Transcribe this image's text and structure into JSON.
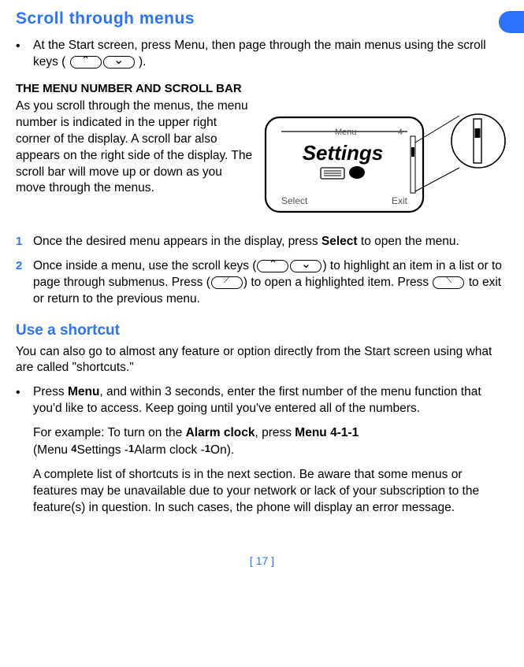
{
  "h1": "Scroll through menus",
  "bullet1_a": "At the Start screen, press Menu, then page through the main menus using the scroll keys (",
  "bullet1_b": ").",
  "subhead": "THE MENU NUMBER AND SCROLL BAR",
  "para1": "As you scroll through the menus, the menu number is indicated in the upper right corner of the display. A scroll bar also appears on the right side of the display. The scroll bar will move up or down as you move through the menus.",
  "step1_a": "Once the desired menu appears in the display, press ",
  "step1_b": "Select",
  "step1_c": " to open the menu.",
  "step2_a": "Once inside a menu, use the scroll keys (",
  "step2_b": ") to highlight an item in a list or to page through submenus. Press (",
  "step2_c": ") to open a highlighted item. Press ",
  "step2_d": " to exit or return to the previous menu.",
  "h2": "Use a shortcut",
  "para2": "You can also go to almost any feature or option directly from the Start screen using what are called \"shortcuts.\"",
  "bullet2_a": "Press ",
  "bullet2_b": "Menu",
  "bullet2_c": ", and within 3 seconds, enter the first number of the menu function that you'd like to access. Keep going until you've entered all of the numbers.",
  "ex_a": "For example: To turn on the ",
  "ex_b": "Alarm clock",
  "ex_c": ", press ",
  "ex_d": "Menu 4-1-1",
  "ex_e": "(Menu ",
  "ex_f": "4",
  "ex_g": "Settings -",
  "ex_h": "1",
  "ex_i": "Alarm clock -",
  "ex_j": "1",
  "ex_k": "On).",
  "para3": "A complete list of shortcuts is in the next section. Be aware that some menus or features may be unavailable due to your network or lack of your subscription to the feature(s) in question. In such cases, the phone will display an error message.",
  "footer": "[ 17 ]",
  "fig": {
    "menu_label": "Menu",
    "menu_num": "4",
    "title": "Settings",
    "left_soft": "Select",
    "right_soft": "Exit"
  }
}
